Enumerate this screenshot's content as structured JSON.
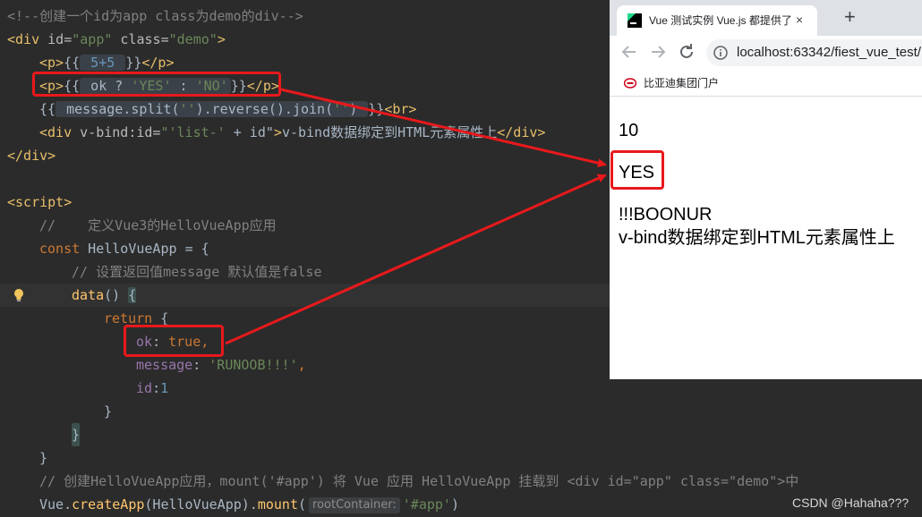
{
  "editor": {
    "l1": "<!--创建一个id为app class为demo的div-->",
    "l2": {
      "open": "<div",
      "id_attr": " id=",
      "id_val": "\"app\"",
      "class_attr": " class=",
      "class_val": "\"demo\"",
      "close": ">"
    },
    "l3": {
      "open": "<p>",
      "lb": "{{",
      "expr": " 5+5 ",
      "rb": "}}",
      "close": "</p>"
    },
    "l4": {
      "open": "<p>",
      "lb": "{{",
      "expr_a": " ok ? ",
      "s1": "'YES'",
      "expr_b": " : ",
      "s2": "'NO'",
      "rb": "}}",
      "close": "</p>"
    },
    "l5": {
      "lb": "{{",
      "expr_a": " message.split(",
      "s1": "''",
      "expr_b": ").reverse().join(",
      "s2": "''",
      "expr_c": ") ",
      "rb": "}}",
      "tail": "<br>"
    },
    "l6": {
      "open": "<div",
      "attr": " v-bind:id=",
      "val_a": "\"'list-'",
      "val_b": " + id\"",
      "gt": ">",
      "text": "v-bind数据绑定到HTML元素属性上",
      "close": "</div>"
    },
    "l7": "</div>",
    "l9": "<script>",
    "l10": "//    定义Vue3的HelloVueApp应用",
    "l11": {
      "kw": "const",
      "name": " HelloVueApp ",
      "rest": "= {"
    },
    "l12": "// 设置返回值message 默认值是false",
    "l13": {
      "fn": "data",
      "rest": "() ",
      "brace": "{"
    },
    "l14": {
      "kw": "return",
      "rest": " {"
    },
    "l15": {
      "prop": "ok",
      "colon": ": ",
      "kw": "true",
      "comma": ","
    },
    "l16": {
      "prop": "message",
      "colon": ": ",
      "str": "'RUNOOB!!!'",
      "comma": ","
    },
    "l17": {
      "prop": "id",
      "colon": ":",
      "num": "1"
    },
    "l18": "}",
    "l19": "}",
    "l20": "}",
    "l21": "// 创建HelloVueApp应用，mount('#app') 将 Vue 应用 HelloVueApp 挂载到 <div id=\"app\" class=\"demo\">中",
    "l22": {
      "obj": "Vue",
      "dot": ".",
      "fn": "createApp",
      "args": "(HelloVueApp).",
      "fn2": "mount",
      "lp": "(",
      "hint": "rootContainer:",
      "str": "'#app'",
      "rp": ")"
    }
  },
  "browser": {
    "tab_title": "Vue 测试实例 Vue.js 都提供了完",
    "tab_close": "×",
    "new_tab": "+",
    "url": "localhost:63342/fiest_vue_test/",
    "bookmark": "比亚迪集团门户",
    "output": {
      "sum": "10",
      "ternary": "YES",
      "reversed": "!!!BOONUR",
      "vbind_text": "v-bind数据绑定到HTML元素属性上"
    }
  },
  "watermark": "CSDN @Hahaha???",
  "colors": {
    "editor_bg": "#2b2b2b",
    "annotation_red": "#e8191c",
    "tag_yellow": "#e8bf6a",
    "keyword_orange": "#cc7832",
    "string_green": "#6a8759"
  }
}
